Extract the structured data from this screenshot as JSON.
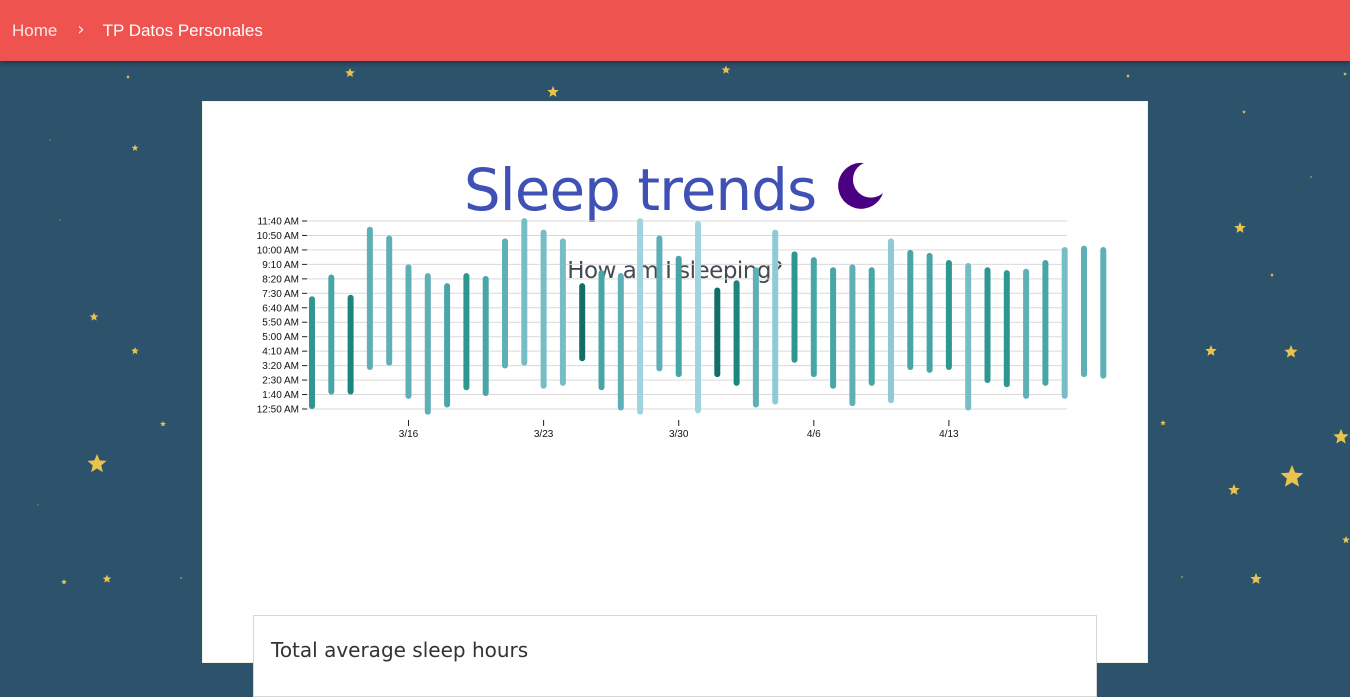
{
  "breadcrumb": {
    "home": "Home",
    "current": "TP Datos Personales"
  },
  "page": {
    "title": "Sleep trends",
    "subtitle": "How am I sleeping?",
    "stat_label": "Total average sleep hours"
  },
  "colors": {
    "topbar": "#ef5350",
    "background": "#2d526b",
    "title": "#3f51b5",
    "moon": "#4b0082",
    "star": "#f2c94c"
  },
  "icons": {
    "moon": "crescent-moon-icon",
    "star": "star-icon",
    "breadcrumb_separator": "chevron-right-icon"
  },
  "chart_data": {
    "type": "bar",
    "title": "",
    "xlabel": "",
    "ylabel": "",
    "y_tick_labels": [
      "12:50 AM",
      "1:40 AM",
      "2:30 AM",
      "3:20 AM",
      "4:10 AM",
      "5:00 AM",
      "5:50 AM",
      "6:40 AM",
      "7:30 AM",
      "8:20 AM",
      "9:10 AM",
      "10:00 AM",
      "10:50 AM",
      "11:40 AM"
    ],
    "x_tick_labels": [
      "3/16",
      "3/23",
      "3/30",
      "4/6",
      "4/13"
    ],
    "x_tick_dates": [
      "2019-03-16",
      "2019-03-23",
      "2019-03-30",
      "2019-04-06",
      "2019-04-13"
    ],
    "ylim_minutes": [
      0,
      750
    ],
    "grid": true,
    "series": [
      {
        "dates": [
          "2019-03-11",
          "2019-03-12",
          "2019-03-13",
          "2019-03-14",
          "2019-03-15",
          "2019-03-16",
          "2019-03-17",
          "2019-03-18",
          "2019-03-19",
          "2019-03-20",
          "2019-03-21",
          "2019-03-22",
          "2019-03-23",
          "2019-03-24",
          "2019-03-25",
          "2019-03-26",
          "2019-03-27",
          "2019-03-28",
          "2019-03-29",
          "2019-03-30",
          "2019-03-31",
          "2019-04-01",
          "2019-04-02",
          "2019-04-03",
          "2019-04-04",
          "2019-04-05",
          "2019-04-06",
          "2019-04-07",
          "2019-04-08",
          "2019-04-09",
          "2019-04-10",
          "2019-04-11",
          "2019-04-12",
          "2019-04-13",
          "2019-04-14",
          "2019-04-15",
          "2019-04-16",
          "2019-04-17",
          "2019-04-18",
          "2019-04-19",
          "2019-04-20",
          "2019-04-21"
        ],
        "sleep_start": [
          "12:50 AM",
          "1:40 AM",
          "1:40 AM",
          "3:05 AM",
          "3:20 AM",
          "1:25 AM",
          "12:30 AM",
          "12:55 AM",
          "1:55 AM",
          "1:35 AM",
          "3:10 AM",
          "3:20 AM",
          "2:00 AM",
          "2:10 AM",
          "3:35 AM",
          "1:55 AM",
          "12:45 AM",
          "12:30 AM",
          "3:00 AM",
          "2:40 AM",
          "12:35 AM",
          "2:40 AM",
          "2:10 AM",
          "12:55 AM",
          "1:05 AM",
          "3:30 AM",
          "2:40 AM",
          "2:00 AM",
          "1:00 AM",
          "2:10 AM",
          "1:10 AM",
          "3:05 AM",
          "2:55 AM",
          "3:05 AM",
          "12:45 AM",
          "2:20 AM",
          "2:05 AM",
          "1:25 AM",
          "2:10 AM",
          "1:25 AM",
          "2:40 AM",
          "2:35 AM"
        ],
        "wake_time": [
          "7:20 AM",
          "8:35 AM",
          "7:25 AM",
          "11:20 AM",
          "10:50 AM",
          "9:10 AM",
          "8:40 AM",
          "8:05 AM",
          "8:40 AM",
          "8:30 AM",
          "10:40 AM",
          "11:50 AM",
          "11:10 AM",
          "10:40 AM",
          "8:05 AM",
          "8:50 AM",
          "8:40 AM",
          "11:50 AM",
          "10:50 AM",
          "9:40 AM",
          "11:40 AM",
          "7:50 AM",
          "8:15 AM",
          "9:00 AM",
          "11:10 AM",
          "9:55 AM",
          "9:35 AM",
          "9:00 AM",
          "9:10 AM",
          "9:00 AM",
          "10:40 AM",
          "10:00 AM",
          "9:50 AM",
          "9:25 AM",
          "9:15 AM",
          "9:00 AM",
          "8:50 AM",
          "8:55 AM",
          "9:25 AM",
          "10:10 AM",
          "10:15 AM",
          "10:10 AM"
        ],
        "duration_hours": [
          6.5,
          6.9,
          5.8,
          8.3,
          7.5,
          7.7,
          8.2,
          7.2,
          6.75,
          6.9,
          7.5,
          8.5,
          9.2,
          8.5,
          4.5,
          6.9,
          7.9,
          11.3,
          7.8,
          7.0,
          11.1,
          5.2,
          6.1,
          8.1,
          10.1,
          6.4,
          6.9,
          7.0,
          8.2,
          6.8,
          9.5,
          6.9,
          6.9,
          6.3,
          8.5,
          6.7,
          6.75,
          7.5,
          7.25,
          8.75,
          7.6,
          7.6
        ]
      }
    ]
  }
}
